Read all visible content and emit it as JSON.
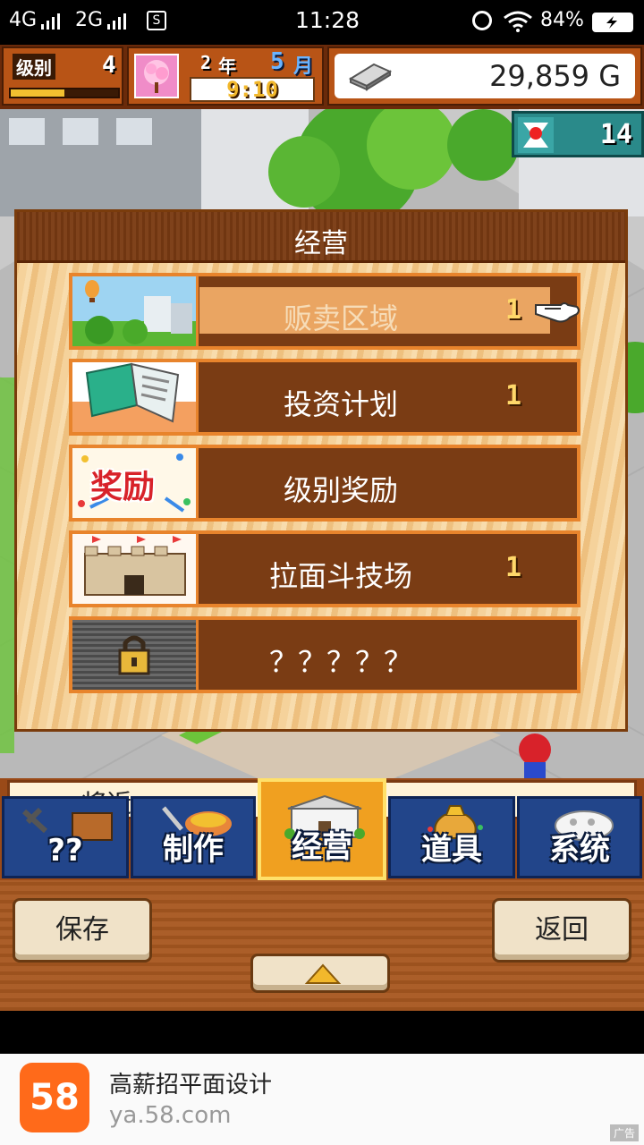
{
  "status_bar": {
    "network1": "4G",
    "network2": "2G",
    "time": "11:28",
    "battery": "84%"
  },
  "hud": {
    "level_label": "级别",
    "level_value": "4",
    "year": "2",
    "year_unit": "年",
    "month": "5",
    "month_unit": "月",
    "clock": "9:10",
    "gold": "29,859 G",
    "rank_value": "14"
  },
  "dialog": {
    "title": "经营",
    "items": [
      {
        "label": "贩卖区域",
        "count": "1",
        "selected": true
      },
      {
        "label": "投资计划",
        "count": "1"
      },
      {
        "label": "级别奖励",
        "count": ""
      },
      {
        "label": "拉面斗技场",
        "count": "1"
      },
      {
        "label": "？？？？？",
        "count": ""
      }
    ],
    "reward_banner": "奖励"
  },
  "bottom": {
    "partial_text": "将近",
    "tabs": [
      {
        "label": "??"
      },
      {
        "label": "制作"
      },
      {
        "label": "经营"
      },
      {
        "label": "道具"
      },
      {
        "label": "系统"
      }
    ],
    "save_label": "保存",
    "back_label": "返回"
  },
  "ad": {
    "logo_text": "58",
    "title": "高薪招平面设计",
    "url": "ya.58.com",
    "badge": "广告"
  },
  "colors": {
    "accent_orange": "#e8842c",
    "menu_brown": "#7a3c14",
    "tab_blue": "#22458a",
    "count_yellow": "#ffd86a"
  }
}
